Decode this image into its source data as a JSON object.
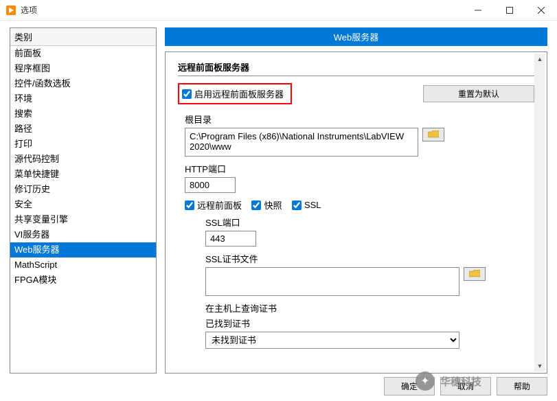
{
  "window": {
    "title": "选项"
  },
  "sidebar": {
    "header": "类别",
    "items": [
      {
        "label": "前面板"
      },
      {
        "label": "程序框图"
      },
      {
        "label": "控件/函数选板"
      },
      {
        "label": "环境"
      },
      {
        "label": "搜索"
      },
      {
        "label": "路径"
      },
      {
        "label": "打印"
      },
      {
        "label": "源代码控制"
      },
      {
        "label": "菜单快捷键"
      },
      {
        "label": "修订历史"
      },
      {
        "label": "安全"
      },
      {
        "label": "共享变量引擎"
      },
      {
        "label": "VI服务器"
      },
      {
        "label": "Web服务器",
        "selected": true
      },
      {
        "label": "MathScript"
      },
      {
        "label": "FPGA模块"
      }
    ]
  },
  "main": {
    "header": "Web服务器",
    "section_title": "远程前面板服务器",
    "enable_checkbox": "启用远程前面板服务器",
    "reset_button": "重置为默认",
    "root_dir_label": "根目录",
    "root_dir_value": "C:\\Program Files (x86)\\National Instruments\\LabVIEW 2020\\www",
    "http_port_label": "HTTP端口",
    "http_port_value": "8000",
    "remote_panel_checkbox": "远程前面板",
    "snapshot_checkbox": "快照",
    "ssl_checkbox": "SSL",
    "ssl_port_label": "SSL端口",
    "ssl_port_value": "443",
    "ssl_cert_file_label": "SSL证书文件",
    "ssl_cert_file_value": "",
    "host_query_label": "在主机上查询证书",
    "found_cert_label": "已找到证书",
    "found_cert_value": "未找到证书"
  },
  "footer": {
    "ok": "确定",
    "cancel": "取消",
    "help": "帮助"
  },
  "watermark": {
    "text": "华穗科技"
  }
}
